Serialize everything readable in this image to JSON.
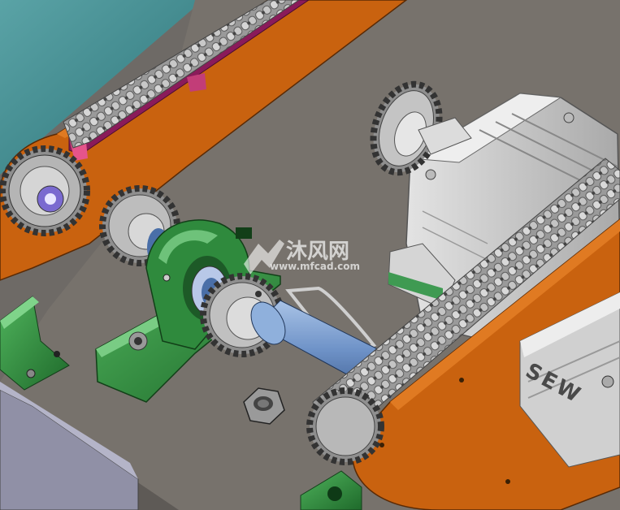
{
  "scene": {
    "palette": {
      "frame_orange": "#c9620f",
      "frame_dark": "#7a3a08",
      "plate_gray": "#77726c",
      "bearing_green": "#2f8a3d",
      "shaft_blue": "#7d9fcf",
      "chain_gray": "#b9b9b9",
      "gearbox_gray": "#cfcfcf",
      "teal_bg": "#3f8f93",
      "magenta_rail": "#8a1b5a"
    },
    "gearbox_brand": "SEW"
  },
  "watermark": {
    "logo_text": "沐风网",
    "url": "www.mfcad.com"
  }
}
